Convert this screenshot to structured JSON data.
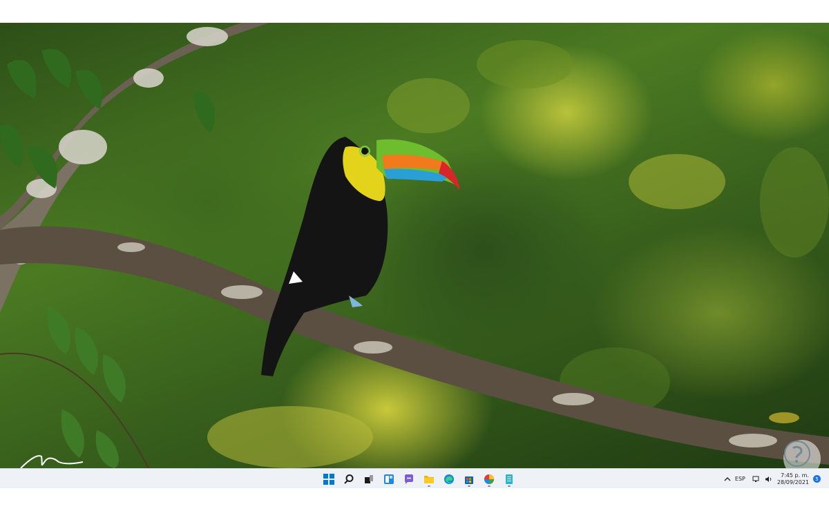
{
  "desktop": {
    "wallpaper": "toucan-on-branch",
    "artist_signature": "handwritten signature"
  },
  "taskbar": {
    "apps": [
      {
        "name": "start-icon"
      },
      {
        "name": "search-icon"
      },
      {
        "name": "task-view-icon"
      },
      {
        "name": "widgets-icon"
      },
      {
        "name": "chat-icon"
      },
      {
        "name": "file-explorer-icon"
      },
      {
        "name": "edge-icon"
      },
      {
        "name": "store-icon"
      },
      {
        "name": "photos-icon"
      },
      {
        "name": "notepad-icon"
      }
    ],
    "tray": {
      "chevron": "chevron-up-icon",
      "language": "ESP",
      "time": "7:45 p. m.",
      "date": "28/09/2021",
      "notifications_count": "5"
    }
  },
  "colors": {
    "start_blue": "#0078d4",
    "taskbar_bg": "#eef1f6",
    "accent": "#1a73e8"
  }
}
